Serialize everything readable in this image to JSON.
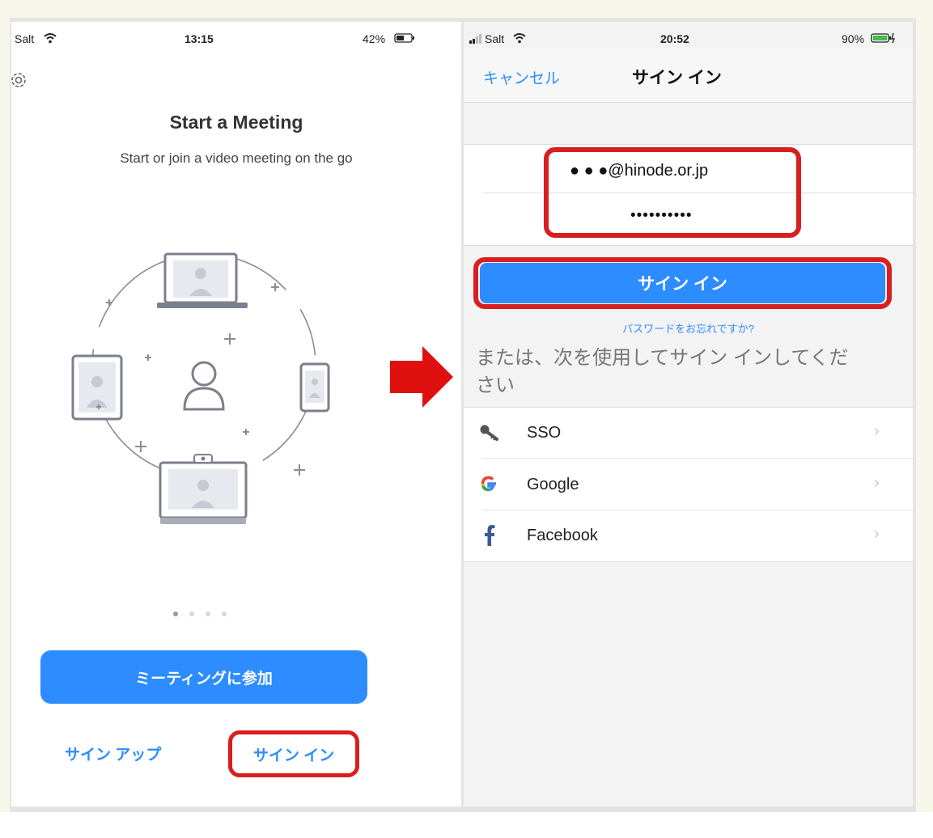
{
  "left_phone": {
    "status": {
      "carrier": "Salt",
      "time": "13:15",
      "battery": "42%"
    },
    "title": "Start a Meeting",
    "subtitle": "Start or join a video meeting on the go",
    "page_indicator": {
      "count": 4,
      "active": 1
    },
    "join_label": "ミーティングに参加",
    "signup_label": "サイン アップ",
    "signin_label": "サイン イン"
  },
  "right_phone": {
    "status": {
      "carrier": "Salt",
      "time": "20:52",
      "battery": "90%"
    },
    "cancel_label": "キャンセル",
    "nav_title": "サイン イン",
    "email_value": "● ● ●@hinode.or.jp",
    "password_value": "••••••••••",
    "signin_button_label": "サイン イン",
    "forgot_label": "パスワードをお忘れですか?",
    "alt_text": "または、次を使用してサイン インしてください",
    "options": [
      {
        "label": "SSO",
        "icon": "key-icon"
      },
      {
        "label": "Google",
        "icon": "google-icon"
      },
      {
        "label": "Facebook",
        "icon": "facebook-icon"
      }
    ]
  },
  "colors": {
    "accent": "#2d8cff",
    "highlight": "#d81f1f",
    "arrow": "#e01010"
  }
}
